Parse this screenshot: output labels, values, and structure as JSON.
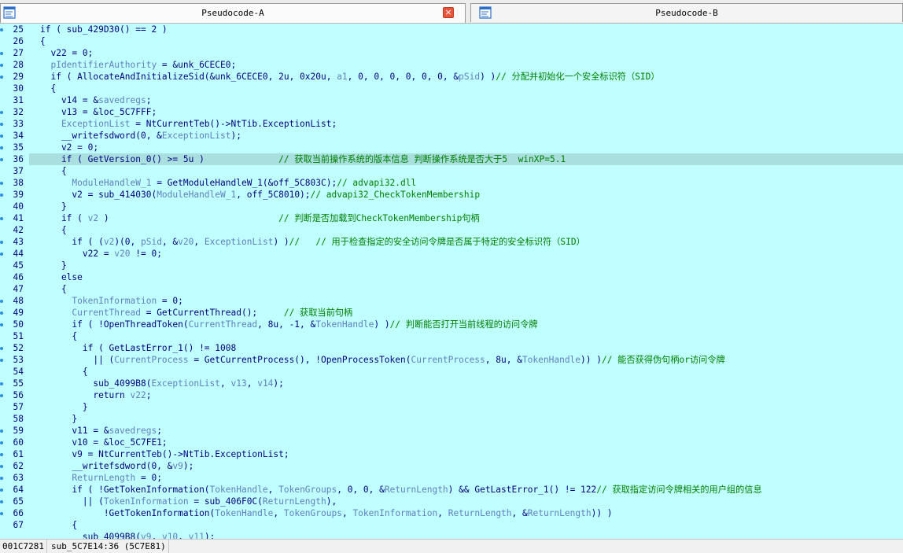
{
  "tabs": [
    {
      "title": "Pseudocode-A",
      "close_symbol": "×"
    },
    {
      "title": "Pseudocode-B"
    }
  ],
  "code": {
    "first_line_number": 25,
    "highlight_line": 36,
    "line_numbers": [
      "25",
      "26",
      "27",
      "28",
      "29",
      "30",
      "31",
      "32",
      "33",
      "34",
      "35",
      "36",
      "37",
      "38",
      "39",
      "40",
      "41",
      "42",
      "43",
      "44",
      "45",
      "46",
      "47",
      "48",
      "49",
      "50",
      "51",
      "52",
      "53",
      "54",
      "55",
      "56",
      "57",
      "58",
      "59",
      "60",
      "61",
      "62",
      "63",
      "64",
      "65",
      "66",
      "67"
    ],
    "lines": [
      [
        [
          "t",
          "if ( sub_429D30() == 2 )"
        ]
      ],
      [
        [
          "t",
          "{"
        ]
      ],
      [
        [
          "t",
          "  v22 = 0;"
        ]
      ],
      [
        [
          "v",
          "  pIdentifierAuthority"
        ],
        [
          "t",
          " = &unk_6CECE0;"
        ]
      ],
      [
        [
          "t",
          "  if ( AllocateAndInitializeSid(&unk_6CECE0, 2u, 0x20u, "
        ],
        [
          "v",
          "a1"
        ],
        [
          "t",
          ", 0, 0, 0, 0, 0, 0, &"
        ],
        [
          "v",
          "pSid"
        ],
        [
          "t",
          ") )"
        ],
        [
          "c",
          "// 分配并初始化一个安全标识符（SID）"
        ]
      ],
      [
        [
          "t",
          "  {"
        ]
      ],
      [
        [
          "t",
          "    v14 = &"
        ],
        [
          "v",
          "savedregs"
        ],
        [
          "t",
          ";"
        ]
      ],
      [
        [
          "t",
          "    v13 = &loc_5C7FFF;"
        ]
      ],
      [
        [
          "v",
          "    ExceptionList"
        ],
        [
          "t",
          " = NtCurrentTeb()->NtTib.ExceptionList;"
        ]
      ],
      [
        [
          "t",
          "    __writefsdword(0, &"
        ],
        [
          "v",
          "ExceptionList"
        ],
        [
          "t",
          ");"
        ]
      ],
      [
        [
          "t",
          "    v2 = 0;"
        ]
      ],
      [
        [
          "t",
          "    if ( GetVersion_0() >= 5u )              "
        ],
        [
          "c",
          "// 获取当前操作系统的版本信息 判断操作系统是否大于5  winXP=5.1"
        ]
      ],
      [
        [
          "t",
          "    {"
        ]
      ],
      [
        [
          "v",
          "      ModuleHandleW_1"
        ],
        [
          "t",
          " = GetModuleHandleW_1(&off_5C803C);"
        ],
        [
          "c",
          "// advapi32.dll"
        ]
      ],
      [
        [
          "t",
          "      v2 = sub_414030("
        ],
        [
          "v",
          "ModuleHandleW_1"
        ],
        [
          "t",
          ", off_5C8010);"
        ],
        [
          "c",
          "// advapi32_CheckTokenMembership"
        ]
      ],
      [
        [
          "t",
          "    }"
        ]
      ],
      [
        [
          "t",
          "    if ( "
        ],
        [
          "v",
          "v2"
        ],
        [
          "t",
          " )                                "
        ],
        [
          "c",
          "// 判断是否加载到CheckTokenMembership句柄"
        ]
      ],
      [
        [
          "t",
          "    {"
        ]
      ],
      [
        [
          "t",
          "      if ( ("
        ],
        [
          "v",
          "v2"
        ],
        [
          "t",
          ")(0, "
        ],
        [
          "v",
          "pSid"
        ],
        [
          "t",
          ", &"
        ],
        [
          "v",
          "v20"
        ],
        [
          "t",
          ", "
        ],
        [
          "v",
          "ExceptionList"
        ],
        [
          "t",
          ") )"
        ],
        [
          "c",
          "//   // 用于检查指定的安全访问令牌是否属于特定的安全标识符（SID）"
        ]
      ],
      [
        [
          "t",
          "        v22 = "
        ],
        [
          "v",
          "v20"
        ],
        [
          "t",
          " != 0;"
        ]
      ],
      [
        [
          "t",
          "    }"
        ]
      ],
      [
        [
          "t",
          "    else"
        ]
      ],
      [
        [
          "t",
          "    {"
        ]
      ],
      [
        [
          "v",
          "      TokenInformation"
        ],
        [
          "t",
          " = 0;"
        ]
      ],
      [
        [
          "v",
          "      CurrentThread"
        ],
        [
          "t",
          " = GetCurrentThread();     "
        ],
        [
          "c",
          "// 获取当前句柄"
        ]
      ],
      [
        [
          "t",
          "      if ( !OpenThreadToken("
        ],
        [
          "v",
          "CurrentThread"
        ],
        [
          "t",
          ", 8u, -1, &"
        ],
        [
          "v",
          "TokenHandle"
        ],
        [
          "t",
          ") )"
        ],
        [
          "c",
          "// 判断能否打开当前线程的访问令牌"
        ]
      ],
      [
        [
          "t",
          "      {"
        ]
      ],
      [
        [
          "t",
          "        if ( GetLastError_1() != 1008"
        ]
      ],
      [
        [
          "t",
          "          || ("
        ],
        [
          "v",
          "CurrentProcess"
        ],
        [
          "t",
          " = GetCurrentProcess(), !OpenProcessToken("
        ],
        [
          "v",
          "CurrentProcess"
        ],
        [
          "t",
          ", 8u, &"
        ],
        [
          "v",
          "TokenHandle"
        ],
        [
          "t",
          ")) )"
        ],
        [
          "c",
          "// 能否获得伪句柄or访问令牌"
        ]
      ],
      [
        [
          "t",
          "        {"
        ]
      ],
      [
        [
          "t",
          "          sub_4099B8("
        ],
        [
          "v",
          "ExceptionList"
        ],
        [
          "t",
          ", "
        ],
        [
          "v",
          "v13"
        ],
        [
          "t",
          ", "
        ],
        [
          "v",
          "v14"
        ],
        [
          "t",
          ");"
        ]
      ],
      [
        [
          "t",
          "          return "
        ],
        [
          "v",
          "v22"
        ],
        [
          "t",
          ";"
        ]
      ],
      [
        [
          "t",
          "        }"
        ]
      ],
      [
        [
          "t",
          "      }"
        ]
      ],
      [
        [
          "t",
          "      v11 = &"
        ],
        [
          "v",
          "savedregs"
        ],
        [
          "t",
          ";"
        ]
      ],
      [
        [
          "t",
          "      v10 = &loc_5C7FE1;"
        ]
      ],
      [
        [
          "t",
          "      v9 = NtCurrentTeb()->NtTib.ExceptionList;"
        ]
      ],
      [
        [
          "t",
          "      __writefsdword(0, &"
        ],
        [
          "v",
          "v9"
        ],
        [
          "t",
          ");"
        ]
      ],
      [
        [
          "v",
          "      ReturnLength"
        ],
        [
          "t",
          " = 0;"
        ]
      ],
      [
        [
          "t",
          "      if ( !GetTokenInformation("
        ],
        [
          "v",
          "TokenHandle"
        ],
        [
          "t",
          ", "
        ],
        [
          "v",
          "TokenGroups"
        ],
        [
          "t",
          ", 0, 0, &"
        ],
        [
          "v",
          "ReturnLength"
        ],
        [
          "t",
          ") && GetLastError_1() != 122"
        ],
        [
          "c",
          "// 获取指定访问令牌相关的用户组的信息"
        ]
      ],
      [
        [
          "t",
          "        || ("
        ],
        [
          "v",
          "TokenInformation"
        ],
        [
          "t",
          " = sub_406F0C("
        ],
        [
          "v",
          "ReturnLength"
        ],
        [
          "t",
          "),"
        ]
      ],
      [
        [
          "t",
          "            !GetTokenInformation("
        ],
        [
          "v",
          "TokenHandle"
        ],
        [
          "t",
          ", "
        ],
        [
          "v",
          "TokenGroups"
        ],
        [
          "t",
          ", "
        ],
        [
          "v",
          "TokenInformation"
        ],
        [
          "t",
          ", "
        ],
        [
          "v",
          "ReturnLength"
        ],
        [
          "t",
          ", &"
        ],
        [
          "v",
          "ReturnLength"
        ],
        [
          "t",
          ")) )"
        ]
      ],
      [
        [
          "t",
          "      {"
        ]
      ],
      [
        [
          "t",
          "        sub_4099B8("
        ],
        [
          "v",
          "v9"
        ],
        [
          "t",
          ", "
        ],
        [
          "v",
          "v10"
        ],
        [
          "t",
          ", "
        ],
        [
          "v",
          "v11"
        ],
        [
          "t",
          ");"
        ]
      ]
    ],
    "breakpoint_dot_lines": [
      "25",
      "27",
      "28",
      "29",
      "32",
      "33",
      "34",
      "35",
      "36",
      "38",
      "39",
      "41",
      "43",
      "44",
      "48",
      "49",
      "50",
      "52",
      "53",
      "55",
      "56",
      "59",
      "60",
      "61",
      "62",
      "63",
      "64",
      "65",
      "66"
    ]
  },
  "status": {
    "address": "001C7281",
    "location": "sub_5C7E14:36 (5C7E81)"
  },
  "colors": {
    "background": "#c0ffff",
    "highlight": "#a9dfdf",
    "text": "#000080",
    "variable": "#5f7fbf",
    "comment": "#008000"
  }
}
